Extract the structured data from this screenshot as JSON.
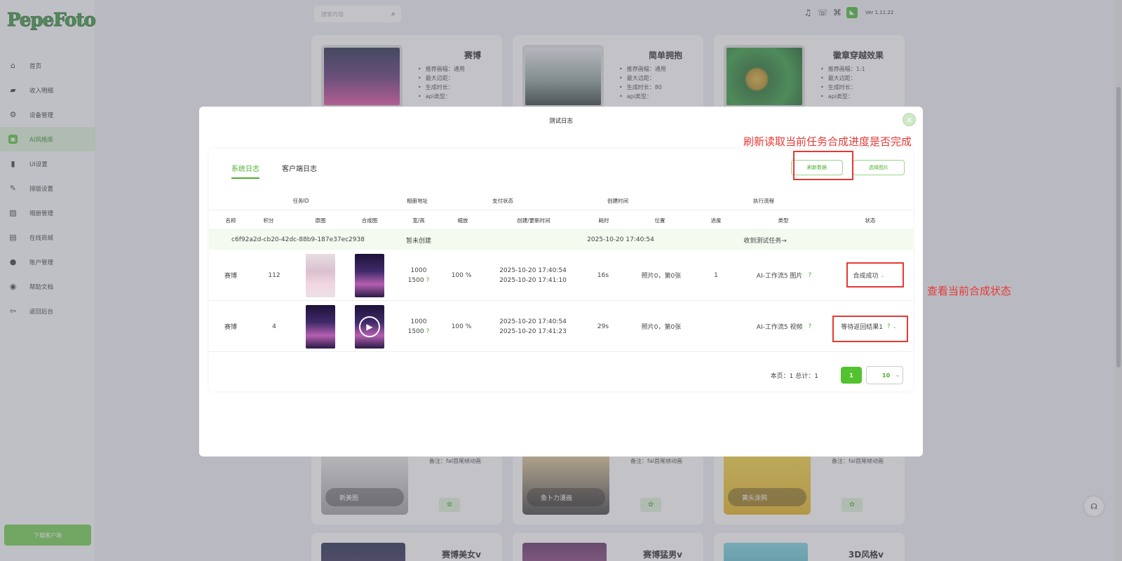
{
  "app": {
    "logo": "PepeFoto",
    "version": "Ver 1.11.22"
  },
  "search": {
    "placeholder": "搜索内容"
  },
  "sidebar": {
    "items": [
      {
        "label": "首页",
        "icon": "home-icon"
      },
      {
        "label": "收入明细",
        "icon": "wallet-icon"
      },
      {
        "label": "设备管理",
        "icon": "gear-icon"
      },
      {
        "label": "AI风格库",
        "icon": "style-icon"
      },
      {
        "label": "UI设置",
        "icon": "ui-icon"
      },
      {
        "label": "排版设置",
        "icon": "layout-icon"
      },
      {
        "label": "相册管理",
        "icon": "album-icon"
      },
      {
        "label": "在线商城",
        "icon": "shop-icon"
      },
      {
        "label": "账户管理",
        "icon": "user-icon"
      },
      {
        "label": "帮助文档",
        "icon": "help-icon"
      },
      {
        "label": "返回后台",
        "icon": "return-icon"
      }
    ],
    "download_label": "下载客户端"
  },
  "cards": [
    {
      "title": "赛博",
      "lines": [
        "推荐画幅：通用",
        "最大边距：",
        "生成时长：",
        "api类型："
      ]
    },
    {
      "title": "简单拥抱",
      "lines": [
        "推荐画幅：通用",
        "最大边距：",
        "生成时长：80",
        "api类型："
      ]
    },
    {
      "title": "徽章穿越效果",
      "lines": [
        "推荐画幅：1:1",
        "最大边距：",
        "生成时长：",
        "api类型："
      ]
    }
  ],
  "bottom_cards": [
    {
      "note": "备注：fal首尾帧动画",
      "label": "新美图"
    },
    {
      "note": "备注：fal首尾帧动画",
      "label": "鱼卜力漫画"
    },
    {
      "note": "备注：fal首尾帧动画",
      "label": "黄头涂鸦"
    }
  ],
  "row3_cards": [
    {
      "title": "赛博美女v"
    },
    {
      "title": "赛博猛男v"
    },
    {
      "title": "3D风格v"
    }
  ],
  "modal": {
    "title": "测试日志",
    "tabs": [
      "系统日志",
      "客户端日志"
    ],
    "refresh_label": "刷新数据",
    "select_label": "选择图片",
    "header1": [
      "任务ID",
      "相册地址",
      "支付状态",
      "创建时间",
      "执行流程"
    ],
    "header2": [
      "名称",
      "积分",
      "原图",
      "合成图",
      "宽/高",
      "缩放",
      "创建/更新时间",
      "耗时",
      "位置",
      "进度",
      "类型",
      "状态"
    ],
    "task": {
      "id": "c6f92a2d-cb20-42dc-88b9-187e37ec2938",
      "album": "暂未创建",
      "created": "2025-10-20 17:40:54",
      "flow": "收到测试任务→"
    },
    "rows": [
      {
        "name": "赛博",
        "points": "112",
        "w": "1000",
        "h": "1500",
        "scale": "100 %",
        "created": "2025-10-20 17:40:54",
        "updated": "2025-10-20 17:41:10",
        "cost": "16s",
        "position": "照片0，第0张",
        "progress": "1",
        "type": "AI-工作流5 图片",
        "status": "合成成功",
        "status_q": ""
      },
      {
        "name": "赛博",
        "points": "4",
        "w": "1000",
        "h": "1500",
        "scale": "100 %",
        "created": "2025-10-20 17:40:54",
        "updated": "2025-10-20 17:41:23",
        "cost": "29s",
        "position": "照片0，第0张",
        "progress": "",
        "type": "AI-工作流5 视频",
        "status": "等待返回结果1",
        "status_q": "?"
      }
    ],
    "pager": {
      "info": "本页：1  总计：1",
      "page": "1",
      "size": "10"
    }
  },
  "annotations": {
    "refresh_note": "刷新读取当前任务合成进度是否完成",
    "status_note": "查看当前合成状态"
  },
  "glyphs": {
    "q": "?",
    "chev": "⌄",
    "close": "×",
    "play": "▶",
    "search": "⌕"
  }
}
